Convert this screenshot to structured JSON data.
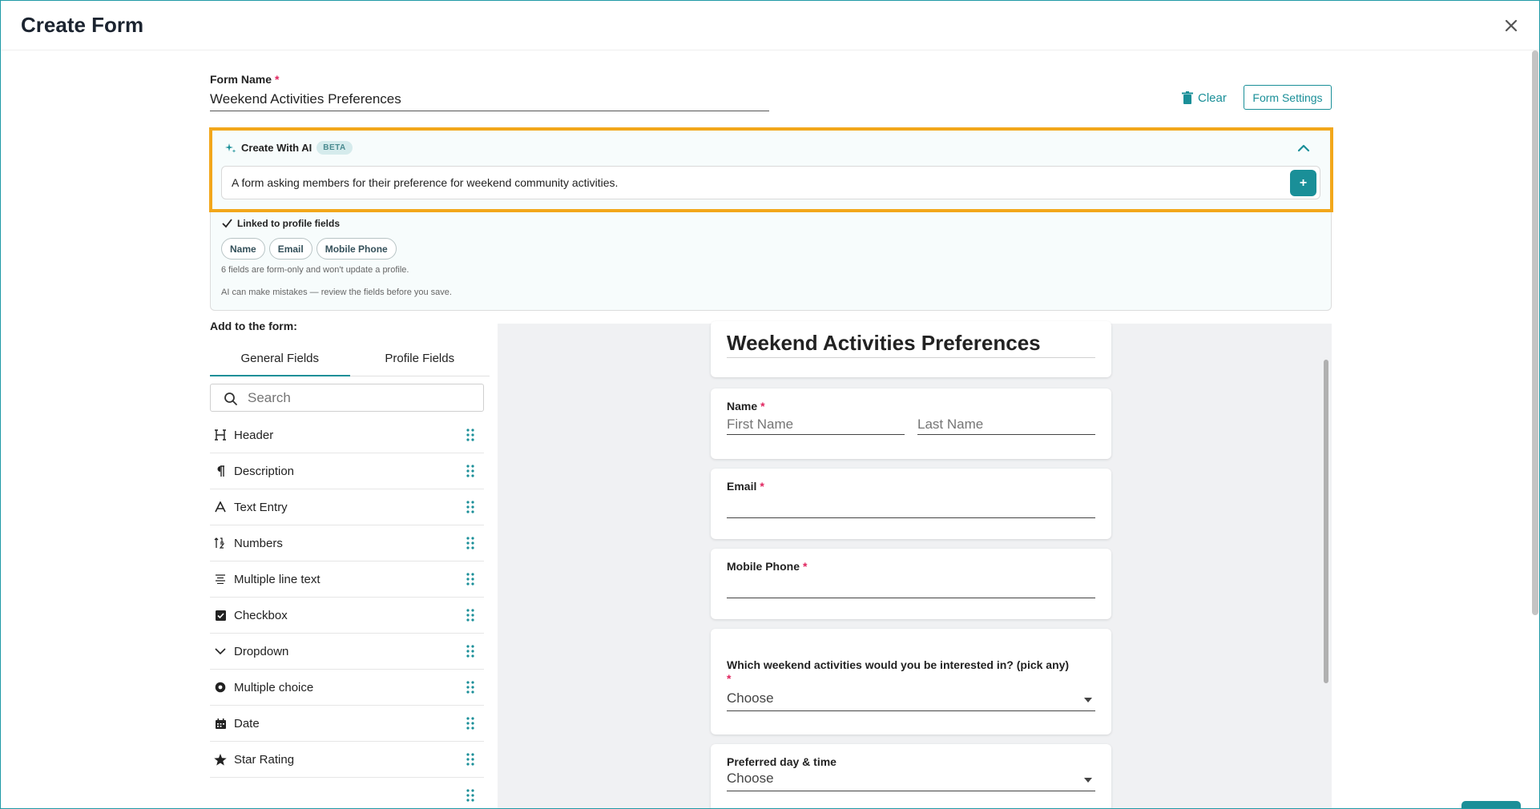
{
  "modal": {
    "title": "Create Form"
  },
  "form_name": {
    "label": "Form Name",
    "required_mark": "*",
    "value": "Weekend Activities Preferences"
  },
  "toolbar": {
    "clear_label": "Clear",
    "settings_label": "Form Settings"
  },
  "ai": {
    "title": "Create With AI",
    "badge": "BETA",
    "prompt": "A form asking members for their preference for weekend community activities.",
    "submit_symbol": "+",
    "linked_label": "Linked to profile fields",
    "linked_fields": [
      "Name",
      "Email",
      "Mobile Phone"
    ],
    "form_only_note": "6 fields are form-only and won't update a profile.",
    "disclaimer": "AI can make mistakes — review the fields before you save."
  },
  "palette": {
    "add_label": "Add to the form:",
    "tabs": [
      "General Fields",
      "Profile Fields"
    ],
    "search_placeholder": "Search",
    "items": [
      {
        "label": "Header",
        "icon": "header-icon"
      },
      {
        "label": "Description",
        "icon": "paragraph-icon"
      },
      {
        "label": "Text Entry",
        "icon": "text-entry-icon"
      },
      {
        "label": "Numbers",
        "icon": "numbers-icon"
      },
      {
        "label": "Multiple line text",
        "icon": "multiline-icon"
      },
      {
        "label": "Checkbox",
        "icon": "checkbox-icon"
      },
      {
        "label": "Dropdown",
        "icon": "dropdown-icon"
      },
      {
        "label": "Multiple choice",
        "icon": "radio-icon"
      },
      {
        "label": "Date",
        "icon": "calendar-icon"
      },
      {
        "label": "Star Rating",
        "icon": "star-icon"
      },
      {
        "label": "",
        "icon": "partial-icon"
      }
    ]
  },
  "preview": {
    "title": "Weekend Activities Preferences",
    "name": {
      "label": "Name",
      "required_mark": "*",
      "first_placeholder": "First Name",
      "last_placeholder": "Last Name"
    },
    "email": {
      "label": "Email",
      "required_mark": "*"
    },
    "mobile": {
      "label": "Mobile Phone",
      "required_mark": "*"
    },
    "activities": {
      "label": "Which weekend activities would you be interested in? (pick any)",
      "required_mark": "*",
      "select_value": "Choose"
    },
    "day_time": {
      "label": "Preferred day & time",
      "select_value": "Choose"
    }
  },
  "colors": {
    "accent": "#1a8f98",
    "highlight": "#f2a71b",
    "required": "#e0245e"
  }
}
